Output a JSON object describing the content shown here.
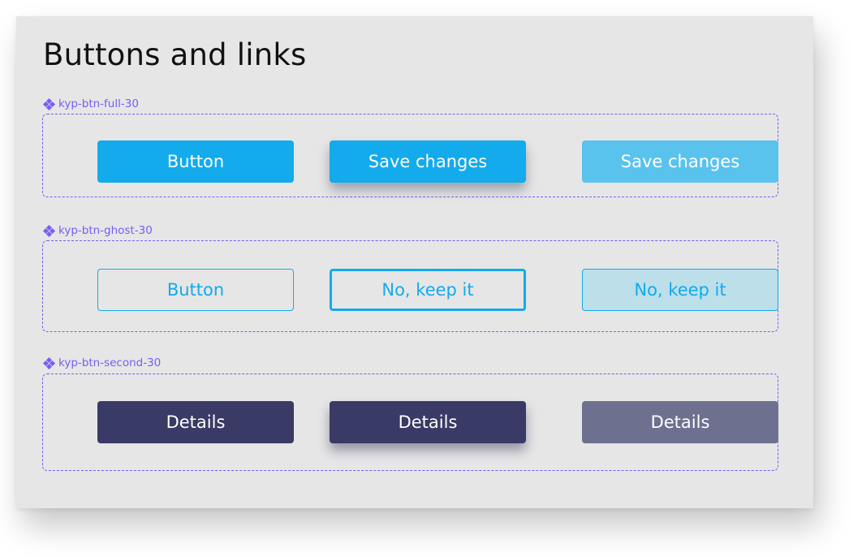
{
  "page": {
    "title": "Buttons and links"
  },
  "colors": {
    "accent": "#13abeb",
    "secondary": "#3a3a66",
    "annotation": "#7b5cf2",
    "canvas": "#e6e6e6"
  },
  "groups": [
    {
      "label": "kyp-btn-full-30",
      "icon": "component-icon",
      "buttons": [
        {
          "label": "Button",
          "state": "default"
        },
        {
          "label": "Save changes",
          "state": "hover"
        },
        {
          "label": "Save changes",
          "state": "disabled"
        }
      ]
    },
    {
      "label": "kyp-btn-ghost-30",
      "icon": "component-icon",
      "buttons": [
        {
          "label": "Button",
          "state": "default"
        },
        {
          "label": "No, keep it",
          "state": "focus"
        },
        {
          "label": "No, keep it",
          "state": "disabled"
        }
      ]
    },
    {
      "label": "kyp-btn-second-30",
      "icon": "component-icon",
      "buttons": [
        {
          "label": "Details",
          "state": "default"
        },
        {
          "label": "Details",
          "state": "hover"
        },
        {
          "label": "Details",
          "state": "disabled"
        }
      ]
    }
  ]
}
